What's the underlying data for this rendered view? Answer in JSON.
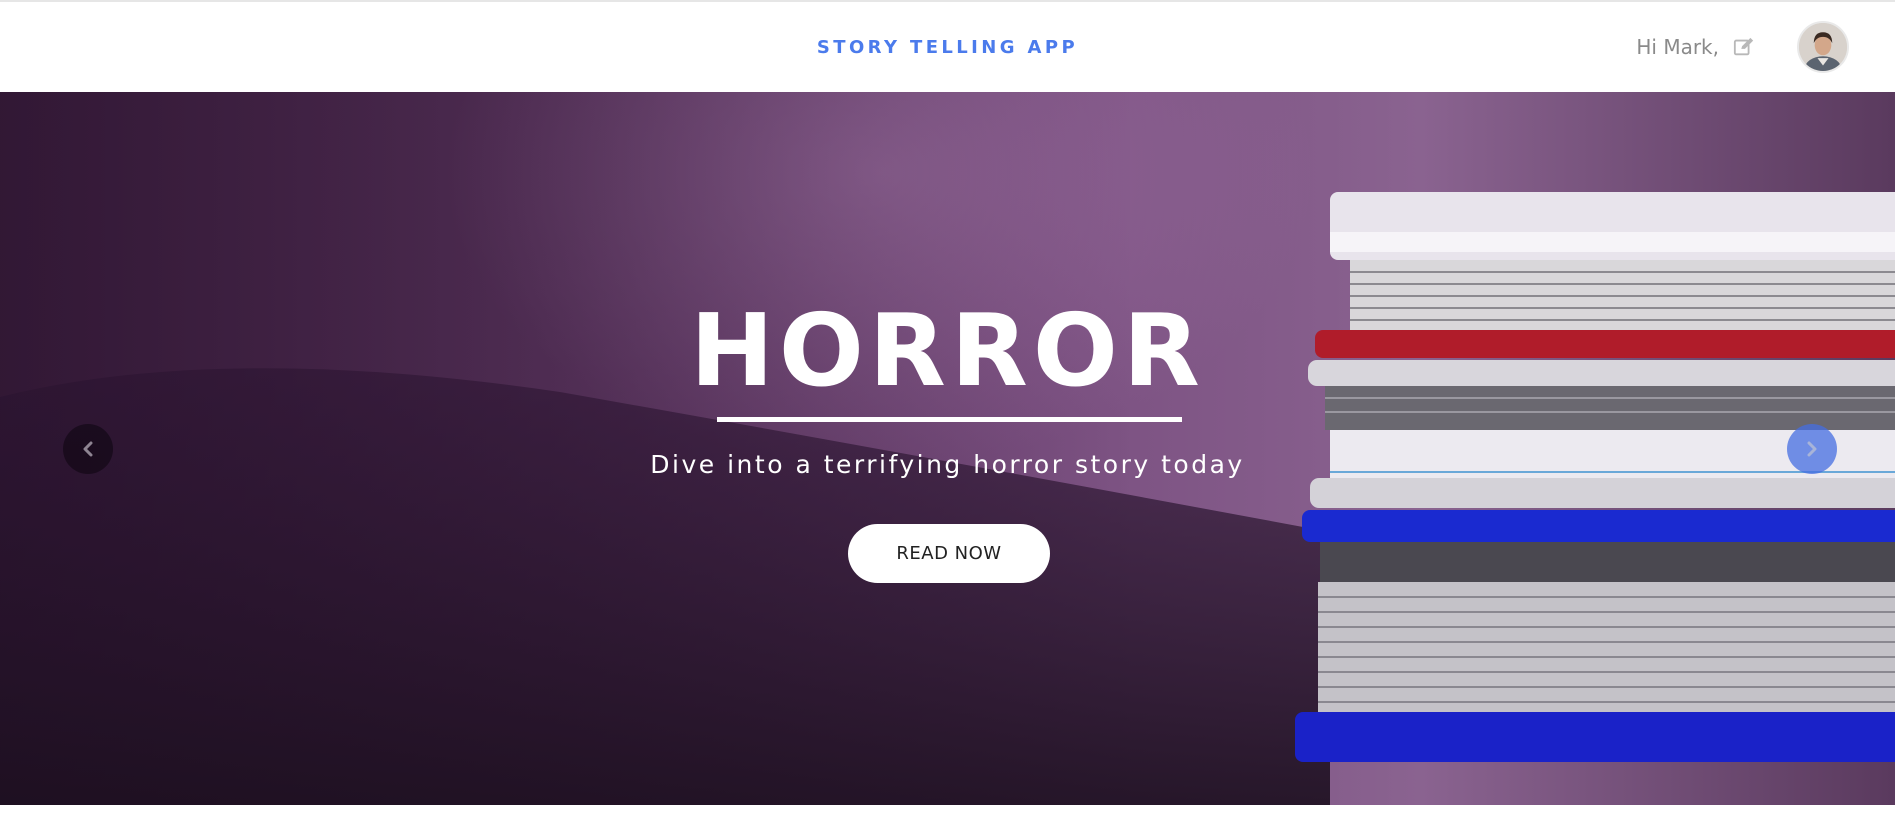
{
  "header": {
    "brand": "STORY TELLING APP",
    "greeting": "Hi Mark,",
    "edit_icon": "edit-icon",
    "avatar_icon": "user-avatar"
  },
  "hero": {
    "title": "HORROR",
    "subtitle": "Dive into a terrifying horror story today",
    "button_label": "READ NOW",
    "prev_icon": "chevron-left-icon",
    "next_icon": "chevron-right-icon"
  },
  "colors": {
    "brand": "#4b7bec",
    "hero_base": "#643a68",
    "next_arrow": "#466ee1"
  }
}
